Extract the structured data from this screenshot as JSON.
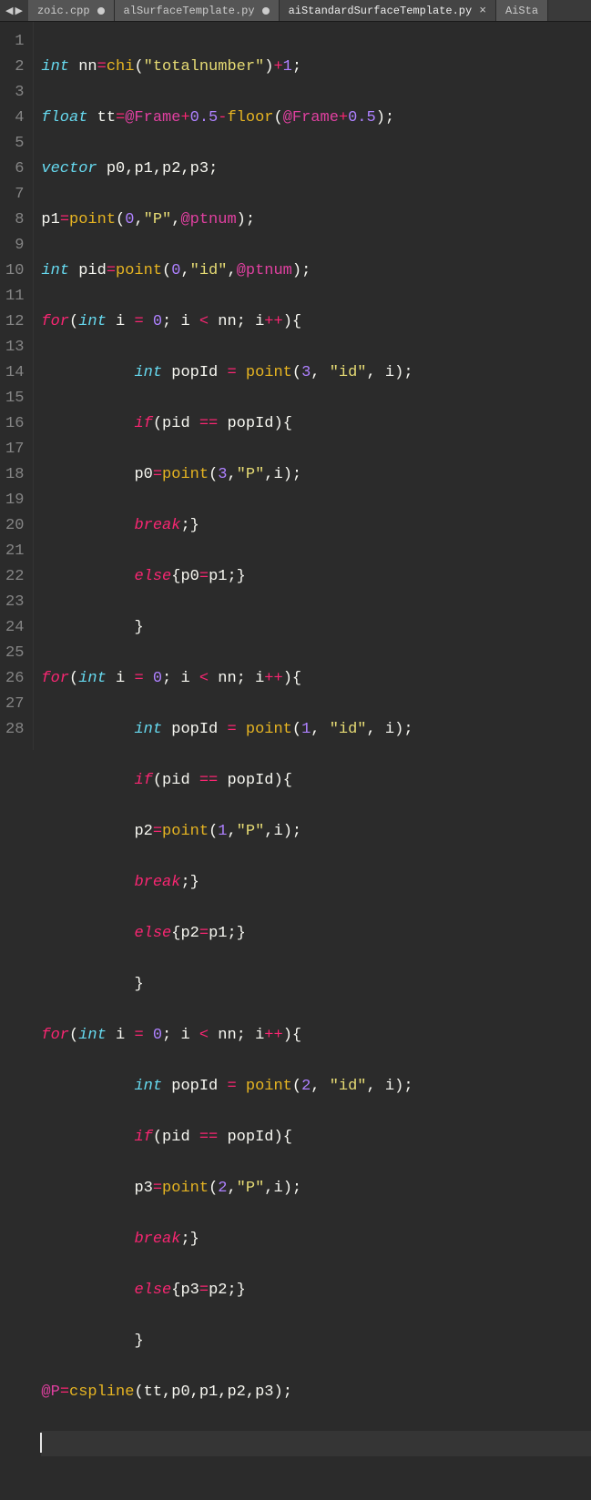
{
  "nav": {
    "left": "◀",
    "right": "▶"
  },
  "tabs": [
    {
      "label": "zoic.cpp",
      "indicator": "dot"
    },
    {
      "label": "alSurfaceTemplate.py",
      "indicator": "dot"
    },
    {
      "label": "aiStandardSurfaceTemplate.py",
      "indicator": "close",
      "active": true
    },
    {
      "label": "AiSta",
      "indicator": ""
    }
  ],
  "lines": [
    "1",
    "2",
    "3",
    "4",
    "5",
    "6",
    "7",
    "8",
    "9",
    "10",
    "11",
    "12",
    "13",
    "14",
    "15",
    "16",
    "17",
    "18",
    "19",
    "20",
    "21",
    "22",
    "23",
    "24",
    "25",
    "26",
    "27",
    "28"
  ],
  "c": {
    "t_int": "int",
    "t_float": "float",
    "t_vector": "vector",
    "sp": " ",
    "nn": "nn",
    "tt": "tt",
    "p0": "p0",
    "p1": "p1",
    "p2": "p2",
    "p3": "p3",
    "pid": "pid",
    "popId": "popId",
    "i": "i",
    "eq": "=",
    "plus": "+",
    "minus": "-",
    "lt": "<",
    "eqeq": "==",
    "incr": "++",
    "semi": ";",
    "comma": ",",
    "lp": "(",
    "rp": ")",
    "lb": "{",
    "rb": "}",
    "chi": "chi",
    "point": "point",
    "floor": "floor",
    "cspline": "cspline",
    "s_totalnumber": "\"totalnumber\"",
    "s_P": "\"P\"",
    "s_id": "\"id\"",
    "n0": "0",
    "n1": "1",
    "n2": "2",
    "n3": "3",
    "n05": "0.5",
    "at_Frame": "@Frame",
    "at_ptnum": "@ptnum",
    "at_P": "@P",
    "kw_for": "for",
    "kw_if": "if",
    "kw_else": "else",
    "kw_break": "break"
  }
}
